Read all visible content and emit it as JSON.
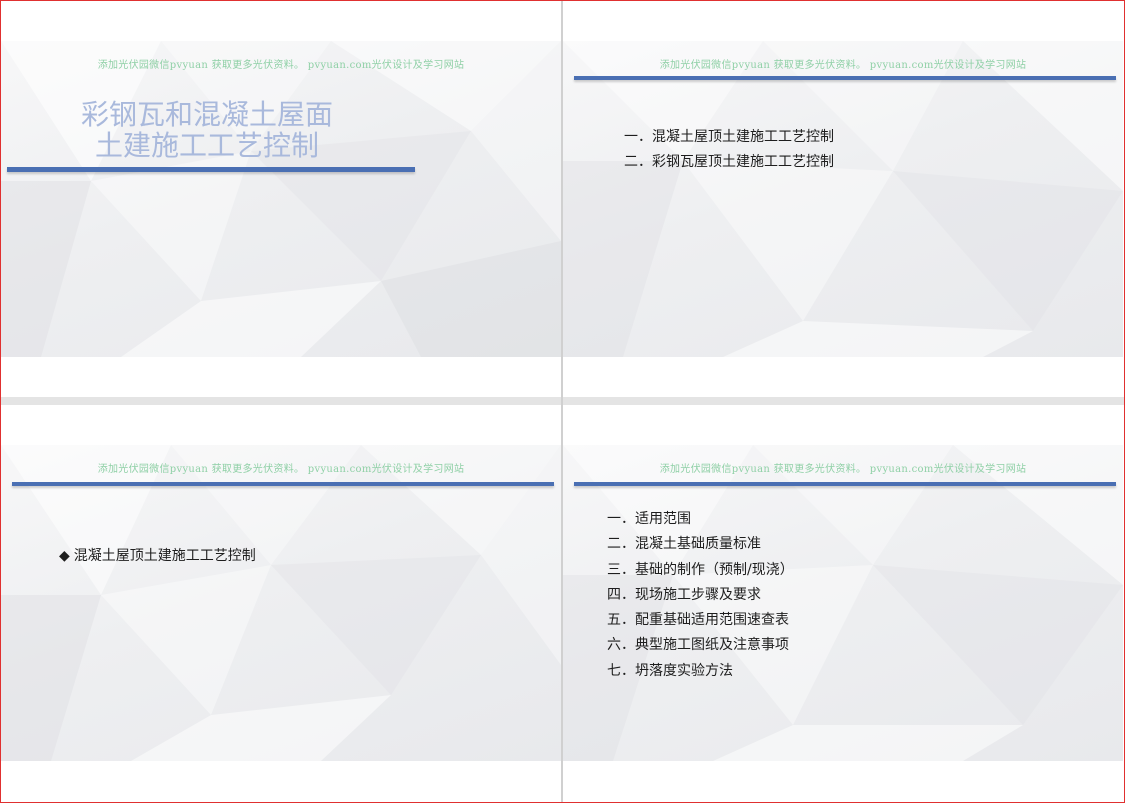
{
  "watermark": "添加光伏园微信pvyuan 获取更多光伏资料。 pvyuan.com光伏设计及学习网站",
  "slide1": {
    "title_line1": "彩钢瓦和混凝土屋面",
    "title_line2": "土建施工工艺控制"
  },
  "slide2": {
    "items": [
      "一．混凝土屋顶土建施工工艺控制",
      "二．彩钢瓦屋顶土建施工工艺控制"
    ]
  },
  "slide3": {
    "bullet": "◆",
    "heading": "混凝土屋顶土建施工工艺控制"
  },
  "slide4": {
    "items": [
      "一．适用范围",
      "二．混凝土基础质量标准",
      "三．基础的制作（预制/现浇）",
      "四．现场施工步骤及要求",
      "五．配重基础适用范围速查表",
      "六．典型施工图纸及注意事项",
      "七．坍落度实验方法"
    ]
  },
  "colors": {
    "frame_border": "#e03030",
    "accent_bar": "#4a6fb3",
    "title_text": "#a9b9dc",
    "watermark_text": "#8fd0a6"
  }
}
